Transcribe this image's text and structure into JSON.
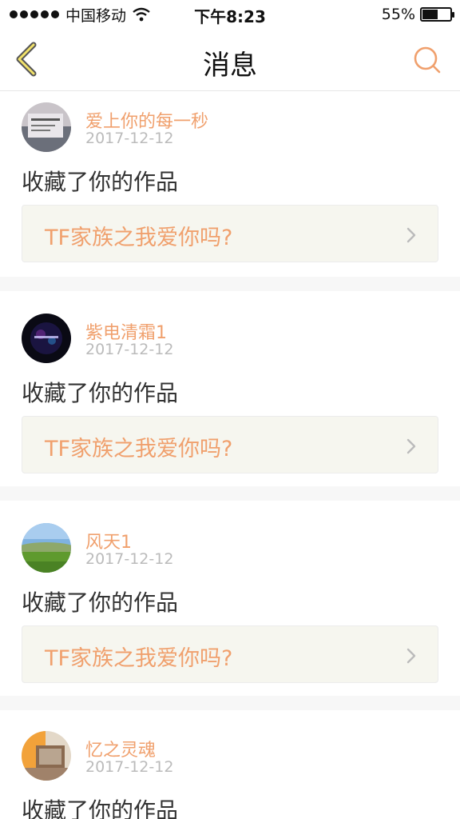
{
  "status_bar": {
    "carrier": "中国移动",
    "time": "下午8:23",
    "battery_percent": "55%",
    "battery_level": 0.55,
    "icons": [
      "signal-dots-icon",
      "wifi-icon",
      "battery-icon"
    ]
  },
  "nav": {
    "title": "消息",
    "back_icon": "chevron-left-icon",
    "search_icon": "search-icon"
  },
  "accent_color": "#f0a06d",
  "messages": [
    {
      "username": "爱上你的每一秒",
      "date": "2017-12-12",
      "action": "收藏了你的作品",
      "work_title": "TF家族之我爱你吗?"
    },
    {
      "username": "紫电清霜1",
      "date": "2017-12-12",
      "action": "收藏了你的作品",
      "work_title": "TF家族之我爱你吗?"
    },
    {
      "username": "风天1",
      "date": "2017-12-12",
      "action": "收藏了你的作品",
      "work_title": "TF家族之我爱你吗?"
    },
    {
      "username": "忆之灵魂",
      "date": "2017-12-12",
      "action": "收藏了你的作品",
      "work_title": ""
    }
  ]
}
